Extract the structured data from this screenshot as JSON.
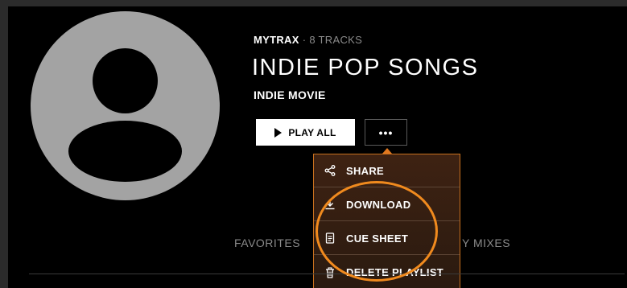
{
  "playlist": {
    "brand": "MYTRAX",
    "separator": "·",
    "track_count": "8 TRACKS",
    "title": "INDIE POP SONGS",
    "subtitle": "INDIE MOVIE"
  },
  "actions": {
    "play_all_label": "PLAY ALL",
    "more_label": "•••"
  },
  "menu": {
    "items": [
      {
        "label": "SHARE",
        "icon": "share-icon"
      },
      {
        "label": "DOWNLOAD",
        "icon": "download-icon"
      },
      {
        "label": "CUE SHEET",
        "icon": "document-icon"
      },
      {
        "label": "DELETE PLAYLIST",
        "icon": "trash-icon"
      }
    ]
  },
  "tabs": {
    "left_visible": "FAVORITES",
    "right_visible_fragment": "Y MIXES"
  },
  "colors": {
    "accent": "#f08a1e",
    "menu_bg": "#2a1a10",
    "avatar": "#a3a3a3"
  }
}
